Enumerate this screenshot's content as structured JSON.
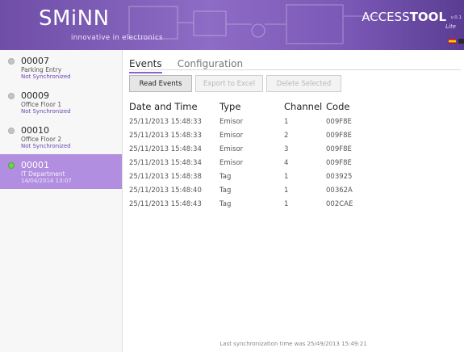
{
  "header": {
    "brand": "SMiNN",
    "tagline": "innovative in electronics",
    "product_prefix": "ACCESS",
    "product_suffix": "TOOL",
    "version": "v.0.1",
    "edition": "Lite",
    "colors": {
      "accent": "#8a63c8",
      "active_device": "#b18ee0",
      "online": "#6ad64b"
    }
  },
  "sidebar": {
    "devices": [
      {
        "id": "00007",
        "name": "Parking Entry",
        "status": "Not Synchronized",
        "active": false
      },
      {
        "id": "00009",
        "name": "Office Floor 1",
        "status": "Not Synchronized",
        "active": false
      },
      {
        "id": "00010",
        "name": "Office Floor 2",
        "status": "Not Synchronized",
        "active": false
      },
      {
        "id": "00001",
        "name": "IT Department",
        "status": "14/04/2014 13:07",
        "active": true
      }
    ]
  },
  "tabs": [
    {
      "label": "Events",
      "active": true
    },
    {
      "label": "Configuration",
      "active": false
    }
  ],
  "toolbar": {
    "read": "Read Events",
    "export": "Export to Excel",
    "delete": "Delete Selected"
  },
  "table": {
    "headers": [
      "Date and Time",
      "Type",
      "Channel",
      "Code"
    ],
    "rows": [
      [
        "25/11/2013 15:48:33",
        "Emisor",
        "1",
        "009F8E"
      ],
      [
        "25/11/2013 15:48:33",
        "Emisor",
        "2",
        "009F8E"
      ],
      [
        "25/11/2013 15:48:34",
        "Emisor",
        "3",
        "009F8E"
      ],
      [
        "25/11/2013 15:48:34",
        "Emisor",
        "4",
        "009F8E"
      ],
      [
        "25/11/2013 15:48:38",
        "Tag",
        "1",
        "003925"
      ],
      [
        "25/11/2013 15:48:40",
        "Tag",
        "1",
        "00362A"
      ],
      [
        "25/11/2013 15:48:43",
        "Tag",
        "1",
        "002CAE"
      ]
    ]
  },
  "footer": {
    "sync_text": "Last synchronization time was 25/49/2013 15:49:21"
  }
}
